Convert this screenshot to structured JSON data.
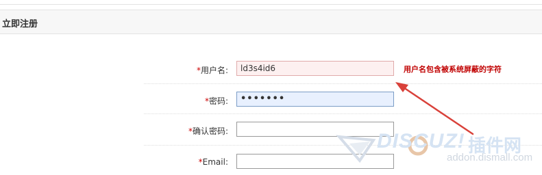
{
  "section": {
    "title": "立即注册"
  },
  "form": {
    "required_mark": "*",
    "username": {
      "label": "用户名:",
      "value": "ld3s4id6"
    },
    "password": {
      "label": "密码:",
      "masked_value": "•••••••"
    },
    "confirm_password": {
      "label": "确认密码:",
      "value": ""
    },
    "email": {
      "label": "Email:",
      "value": ""
    }
  },
  "validation": {
    "username_error": "用户名包含被系统屏蔽的字符"
  },
  "watermark": {
    "brand": "DISCUZ!",
    "cn": "插件网",
    "url": "addon.dismall.com"
  },
  "colors": {
    "error_text": "#c00000",
    "annotation_arrow": "#d9413a",
    "required_mark": "#cc0000"
  }
}
